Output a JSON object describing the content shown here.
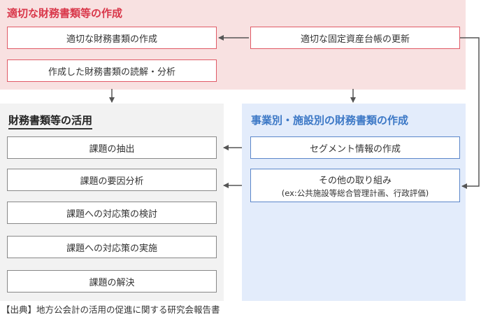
{
  "sections": {
    "top": {
      "title": "適切な財務書類等の作成",
      "boxes": [
        "適切な財務書類の作成",
        "作成した財務書類の読解・分析",
        "適切な固定資産台帳の更新"
      ]
    },
    "left": {
      "title": "財務書類等の活用",
      "boxes": [
        "課題の抽出",
        "課題の要因分析",
        "課題への対応策の検討",
        "課題への対応策の実施",
        "課題の解決"
      ]
    },
    "right": {
      "title": "事業別・施設別の財務書類の作成",
      "segment_box": "セグメント情報の作成",
      "other_box": {
        "title": "その他の取り組み",
        "sub": "(ex:公共施設等総合管理計画、行政評価)"
      }
    }
  },
  "footer": "【出典】地方公会計の活用の促進に関する研究会報告書",
  "colors": {
    "top_panel": "#f8e1e1",
    "left_panel": "#f2f2f2",
    "right_panel": "#e3ecfb",
    "top_title": "#d9374a",
    "right_title": "#3c78c6",
    "arrow": "#555555"
  }
}
